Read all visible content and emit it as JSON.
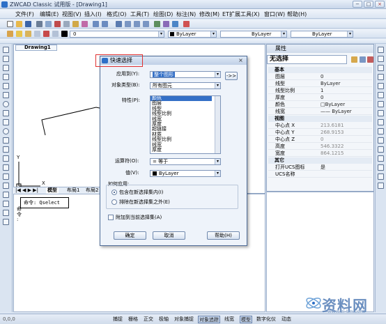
{
  "window": {
    "title": "ZWCAD Classic 试用版 - [Drawing1]",
    "min": "−",
    "max": "□",
    "close": "×"
  },
  "menu": [
    "文件(F)",
    "编辑(E)",
    "视图(V)",
    "插入(I)",
    "格式(O)",
    "工具(T)",
    "绘图(D)",
    "标注(N)",
    "修改(M)",
    "ET扩展工具(X)",
    "窗口(W)",
    "帮助(H)"
  ],
  "toolbar": {
    "layer_combo": "0",
    "color_combo": "ByLayer",
    "linetype_combo": "ByLayer",
    "lineweight_combo": "ByLayer"
  },
  "drawing": {
    "tab": "Drawing1",
    "axis_x": "X",
    "axis_y": "Y"
  },
  "layout_tabs": [
    "模型",
    "布局1",
    "布局2"
  ],
  "command": {
    "prompt": "命令: Qselect",
    "history_side": [
      "命",
      "令",
      ":"
    ]
  },
  "properties": {
    "header": "属性",
    "selection": "无选择",
    "sections": {
      "basic": "基本",
      "view": "视图",
      "other": "其它"
    },
    "basic_rows": [
      {
        "k": "图层",
        "v": "0"
      },
      {
        "k": "线型",
        "v": "ByLayer"
      },
      {
        "k": "线型比例",
        "v": "1"
      },
      {
        "k": "厚度",
        "v": "0"
      },
      {
        "k": "颜色",
        "v": "□ByLayer"
      },
      {
        "k": "线宽",
        "v": "—— ByLayer"
      }
    ],
    "view_rows": [
      {
        "k": "中心点 X",
        "v": "213.6181"
      },
      {
        "k": "中心点 Y",
        "v": "268.9153"
      },
      {
        "k": "中心点 Z",
        "v": "0"
      },
      {
        "k": "高度",
        "v": "546.3322"
      },
      {
        "k": "宽度",
        "v": "864.1215"
      }
    ],
    "other_rows": [
      {
        "k": "打开UCS图标",
        "v": "是"
      },
      {
        "k": "UCS名称",
        "v": ""
      }
    ]
  },
  "dialog": {
    "title": "快速选择",
    "apply_to_label": "应用到(Y):",
    "apply_to_value": "整个图形",
    "object_type_label": "对象类型(B):",
    "object_type_value": "所有图元",
    "properties_label": "特性(P):",
    "property_items": [
      "颜色",
      "图层",
      "线型",
      "线型比例",
      "线宽",
      "厚度",
      "超链接",
      "材质",
      "线型比例",
      "线宽",
      "厚度"
    ],
    "operator_label": "运算符(O):",
    "operator_value": "= 等于",
    "value_label": "值(V):",
    "value_value": "ByLayer",
    "how_label": "如何应用:",
    "radio_include": "包含在新选择集内(I)",
    "radio_exclude": "排除在新选择集之外(E)",
    "append_check": "附加到当前选择集(A)",
    "ok": "确定",
    "cancel": "取消",
    "help": "帮助(H)",
    "pick_button": "->>"
  },
  "statusbar": {
    "coords": "0,0,0",
    "buttons": [
      "捕捉",
      "栅格",
      "正交",
      "极轴",
      "对象捕捉",
      "对象追踪",
      "线宽",
      "模型",
      "数字化仪",
      "动态"
    ]
  },
  "watermark": {
    "text": "资料网",
    "url": "www.zl-tm.com"
  }
}
